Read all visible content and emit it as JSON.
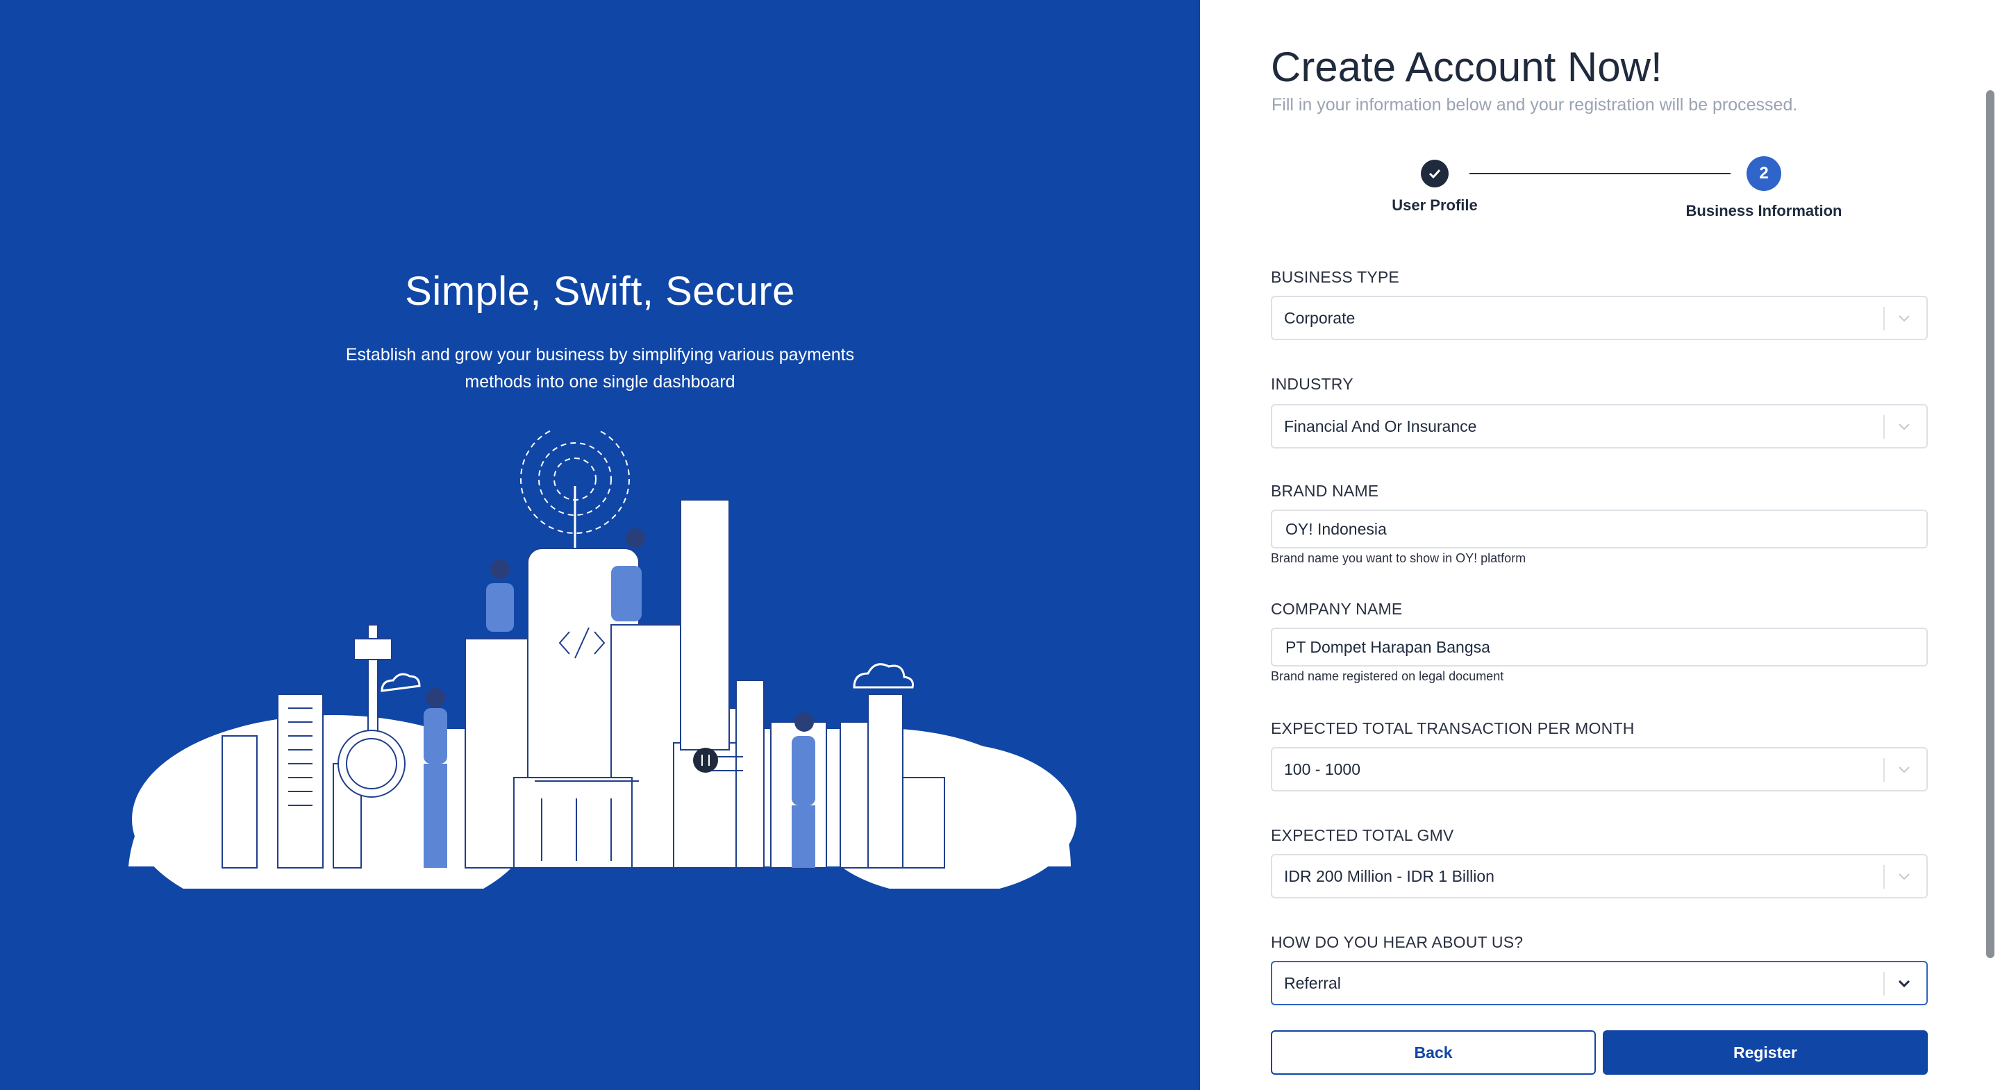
{
  "hero": {
    "title": "Simple, Swift, Secure",
    "text": "Establish and grow your business by simplifying various payments methods into one single dashboard"
  },
  "form_header": {
    "title": "Create Account Now!",
    "subtitle": "Fill in your information below and your registration will be processed."
  },
  "stepper": {
    "steps": [
      {
        "label": "User Profile",
        "state": "completed",
        "icon": "check-icon"
      },
      {
        "label": "Business Information",
        "state": "active",
        "number": "2"
      }
    ]
  },
  "fields": {
    "business_type": {
      "label": "BUSINESS TYPE",
      "value": "Corporate"
    },
    "industry": {
      "label": "INDUSTRY",
      "value": "Financial And Or Insurance"
    },
    "brand_name": {
      "label": "BRAND NAME",
      "value": "OY! Indonesia",
      "helper": "Brand name you want to show in OY! platform"
    },
    "company_name": {
      "label": "COMPANY NAME",
      "value": "PT Dompet Harapan Bangsa",
      "helper": "Brand name registered on legal document"
    },
    "transaction": {
      "label": "EXPECTED TOTAL TRANSACTION PER MONTH",
      "value": "100 - 1000"
    },
    "gmv": {
      "label": "EXPECTED TOTAL GMV",
      "value": "IDR 200 Million - IDR 1 Billion"
    },
    "source": {
      "label": "HOW DO YOU HEAR ABOUT US?",
      "value": "Referral"
    }
  },
  "buttons": {
    "back": "Back",
    "register": "Register"
  },
  "colors": {
    "brand_blue": "#1046a6",
    "accent": "#2f64c8",
    "text_dark": "#1f2a3d"
  }
}
